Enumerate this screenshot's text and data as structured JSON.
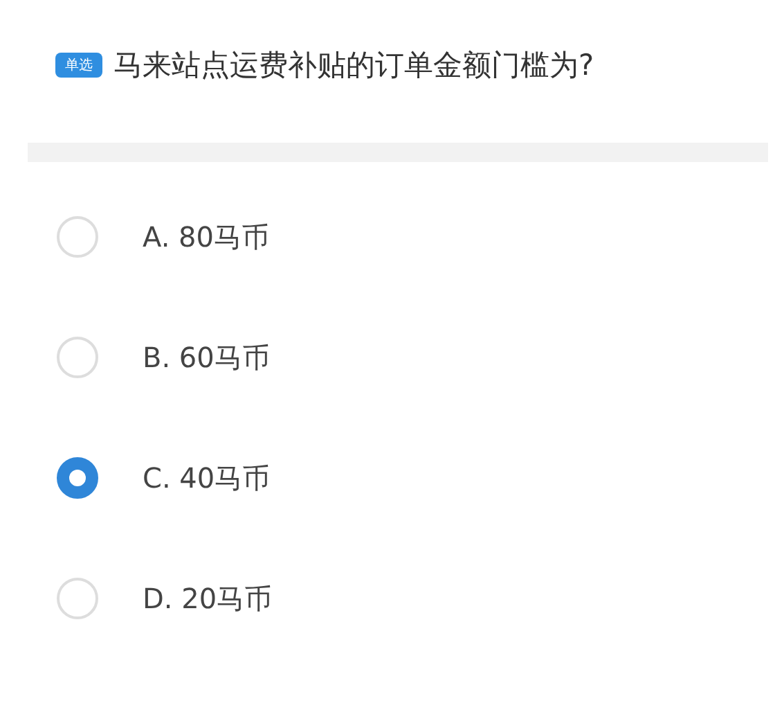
{
  "question": {
    "badge": "单选",
    "text": "马来站点运费补贴的订单金额门槛为?"
  },
  "options": [
    {
      "label": "A. 80马币",
      "selected": false
    },
    {
      "label": "B. 60马币",
      "selected": false
    },
    {
      "label": "C. 40马币",
      "selected": true
    },
    {
      "label": "D. 20马币",
      "selected": false
    }
  ]
}
